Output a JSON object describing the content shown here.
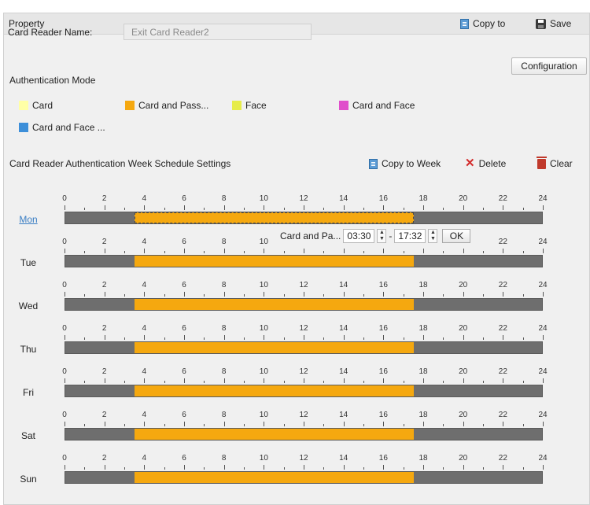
{
  "header": {
    "title": "Property",
    "copy_to_label": "Copy to",
    "save_label": "Save"
  },
  "reader": {
    "name_label": "Card Reader Name:",
    "name_value": "Exit Card Reader2"
  },
  "auth": {
    "section_label": "Authentication Mode",
    "configuration_label": "Configuration",
    "legend": [
      {
        "label": "Card",
        "color": "#ffffa6"
      },
      {
        "label": "Card and Pass...",
        "color": "#f5a80f"
      },
      {
        "label": "Face",
        "color": "#e6ec4a"
      },
      {
        "label": "Card and Face",
        "color": "#e04fcb"
      },
      {
        "label": "Card and Face ...",
        "color": "#3d8fd9"
      }
    ]
  },
  "schedule": {
    "title": "Card Reader Authentication Week Schedule Settings",
    "copy_to_week_label": "Copy to Week",
    "delete_label": "Delete",
    "clear_label": "Clear",
    "hour_labels": [
      "0",
      "2",
      "4",
      "6",
      "8",
      "10",
      "12",
      "14",
      "16",
      "18",
      "20",
      "22",
      "24"
    ],
    "days": [
      {
        "label": "Mon",
        "start_hour": 3.5,
        "end_hour": 17.53
      },
      {
        "label": "Tue",
        "start_hour": 3.5,
        "end_hour": 17.53
      },
      {
        "label": "Wed",
        "start_hour": 3.5,
        "end_hour": 17.53
      },
      {
        "label": "Thu",
        "start_hour": 3.5,
        "end_hour": 17.53
      },
      {
        "label": "Fri",
        "start_hour": 3.5,
        "end_hour": 17.53
      },
      {
        "label": "Sat",
        "start_hour": 3.5,
        "end_hour": 17.53
      },
      {
        "label": "Sun",
        "start_hour": 3.5,
        "end_hour": 17.53
      }
    ],
    "segment_color": "#f5a80f",
    "editor": {
      "mode_label": "Card and Pa...",
      "start_time": "03:30",
      "separator": "-",
      "end_time": "17:32",
      "ok_label": "OK"
    }
  }
}
